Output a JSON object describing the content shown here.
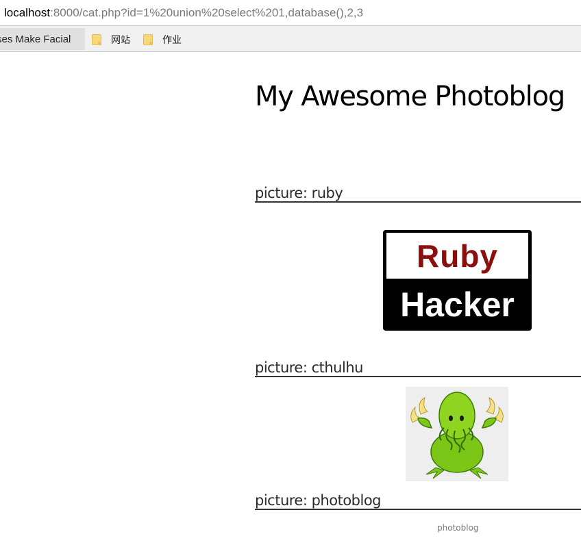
{
  "browser": {
    "url_host": "localhost",
    "url_rest": ":8000/cat.php?id=1%20union%20select%201,database(),2,3",
    "bookmarks": {
      "partial_tab": "rses Make Facial",
      "items": [
        {
          "label": "网站",
          "icon": "folder-icon"
        },
        {
          "label": "作业",
          "icon": "folder-icon"
        }
      ]
    }
  },
  "page": {
    "title": "My Awesome Photoblog",
    "pictures": [
      {
        "heading": "picture: ruby",
        "image": {
          "top_text": "Ruby",
          "bottom_text": "Hacker"
        }
      },
      {
        "heading": "picture: cthulhu",
        "image": {
          "description": "cthulhu-cartoon"
        }
      },
      {
        "heading": "picture: photoblog",
        "alt": "photoblog"
      }
    ]
  },
  "colors": {
    "ruby_red": "#8b0f0f",
    "cthulhu_green": "#7cc618",
    "heading_rule": "#333333"
  }
}
